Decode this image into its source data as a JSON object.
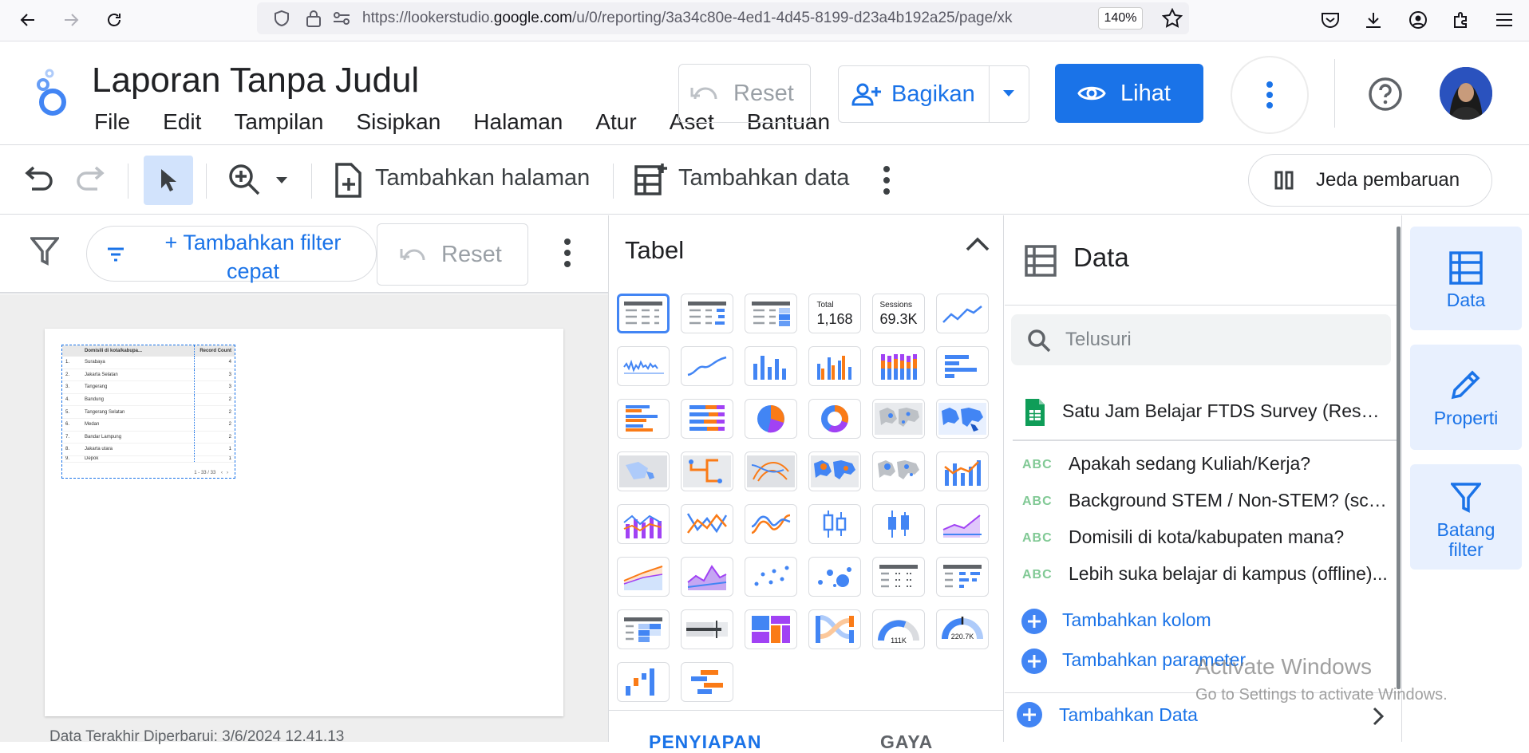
{
  "browser": {
    "url_prefix": "https://lookerstudio.",
    "url_domain": "google.com",
    "url_rest": "/u/0/reporting/3a34c80e-4ed1-4d45-8199-d23a4b192a25/page/xk",
    "zoom": "140%"
  },
  "header": {
    "title": "Laporan Tanpa Judul",
    "menu": [
      "File",
      "Edit",
      "Tampilan",
      "Sisipkan",
      "Halaman",
      "Atur",
      "Aset",
      "Bantuan"
    ],
    "reset_label": "Reset",
    "share_label": "Bagikan",
    "view_label": "Lihat"
  },
  "toolbar": {
    "add_page_label": "Tambahkan halaman",
    "add_data_label": "Tambahkan data",
    "pause_label": "Jeda pembaruan"
  },
  "filterbar": {
    "quick_filter_label": "+ Tambahkan filter cepat",
    "reset_label": "Reset"
  },
  "canvas": {
    "table_headers": [
      "Domisili di kota/kabupa...",
      "Record Count"
    ],
    "table_rows": [
      {
        "n": "1.",
        "name": "Surabaya",
        "count": "4"
      },
      {
        "n": "2.",
        "name": "Jakarta Selatan",
        "count": "3"
      },
      {
        "n": "3.",
        "name": "Tangerang",
        "count": "3"
      },
      {
        "n": "4.",
        "name": "Bandung",
        "count": "2"
      },
      {
        "n": "5.",
        "name": "Tangerang Selatan",
        "count": "2"
      },
      {
        "n": "6.",
        "name": "Medan",
        "count": "2"
      },
      {
        "n": "7.",
        "name": "Bandar Lampung",
        "count": "2"
      },
      {
        "n": "8.",
        "name": "Jakarta utara",
        "count": "1"
      },
      {
        "n": "9.",
        "name": "Depok",
        "count": "1"
      }
    ],
    "pagination": "1 - 33 / 33",
    "last_updated": "Data Terakhir Diperbarui: 3/6/2024 12.41.13"
  },
  "chart_picker": {
    "title": "Tabel",
    "scorecard_1_label": "Total",
    "scorecard_1_value": "1,168",
    "scorecard_2_label": "Sessions",
    "scorecard_2_value": "69.3K",
    "gauge_1_value": "111K",
    "gauge_2_value": "220.7K",
    "tab_setup": "PENYIAPAN",
    "tab_style": "GAYA"
  },
  "data_panel": {
    "title": "Data",
    "search_placeholder": "Telusuri",
    "source_name": "Satu Jam Belajar FTDS Survey (Respo...",
    "fields": [
      {
        "type": "ABC",
        "name": "Apakah sedang Kuliah/Kerja?"
      },
      {
        "type": "ABC",
        "name": "Background STEM / Non-STEM? (scie..."
      },
      {
        "type": "ABC",
        "name": "Domisili di kota/kabupaten mana?"
      },
      {
        "type": "ABC",
        "name": "Lebih suka belajar di kampus (offline)..."
      }
    ],
    "add_column_label": "Tambahkan kolom",
    "add_parameter_label": "Tambahkan parameter",
    "add_data_label": "Tambahkan Data"
  },
  "side_tabs": {
    "data_label": "Data",
    "properties_label": "Properti",
    "filter_bar_label": "Batang filter"
  },
  "watermark": {
    "line1": "Activate Windows",
    "line2": "Go to Settings to activate Windows."
  },
  "colors": {
    "accent": "#1a73e8",
    "chart_blue": "#4285f4",
    "chart_orange": "#fa7b17",
    "chart_purple": "#a142f4"
  }
}
